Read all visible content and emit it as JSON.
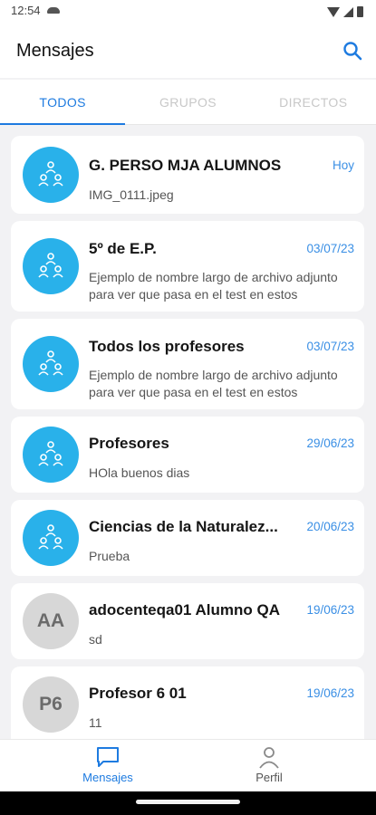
{
  "status_bar": {
    "time": "12:54"
  },
  "header": {
    "title": "Mensajes",
    "search_icon": "search-icon"
  },
  "tabs": [
    {
      "label": "TODOS"
    },
    {
      "label": "GRUPOS"
    },
    {
      "label": "DIRECTOS"
    }
  ],
  "conversations": [
    {
      "title": "G. PERSO MJA ALUMNOS",
      "date": "Hoy",
      "last_message": "IMG_0111.jpeg",
      "avatar": "group-icon"
    },
    {
      "title": "5º de E.P.",
      "date": "03/07/23",
      "last_message": "Ejemplo de nombre largo de archivo adjunto para ver que pasa en el test en estos",
      "avatar": "group-icon"
    },
    {
      "title": "Todos los profesores",
      "date": "03/07/23",
      "last_message": "Ejemplo de nombre largo de archivo adjunto para ver que pasa en el test en estos",
      "avatar": "group-icon"
    },
    {
      "title": "Profesores",
      "date": "29/06/23",
      "last_message": "HOla buenos dias",
      "avatar": "group-icon"
    },
    {
      "title": "Ciencias de la Naturalez...",
      "date": "20/06/23",
      "last_message": "Prueba",
      "avatar": "group-icon"
    },
    {
      "title": "adocenteqa01 Alumno QA",
      "date": "19/06/23",
      "last_message": "sd",
      "initials": "AA"
    },
    {
      "title": "Profesor 6 01",
      "date": "19/06/23",
      "last_message": "11",
      "initials": "P6"
    }
  ],
  "bottom_nav": [
    {
      "label": "Mensajes",
      "icon": "chat-icon"
    },
    {
      "label": "Perfil",
      "icon": "person-icon"
    }
  ],
  "colors": {
    "accent": "#1e7be0",
    "group_avatar": "#29b1ea",
    "user_avatar": "#d7d7d7"
  }
}
